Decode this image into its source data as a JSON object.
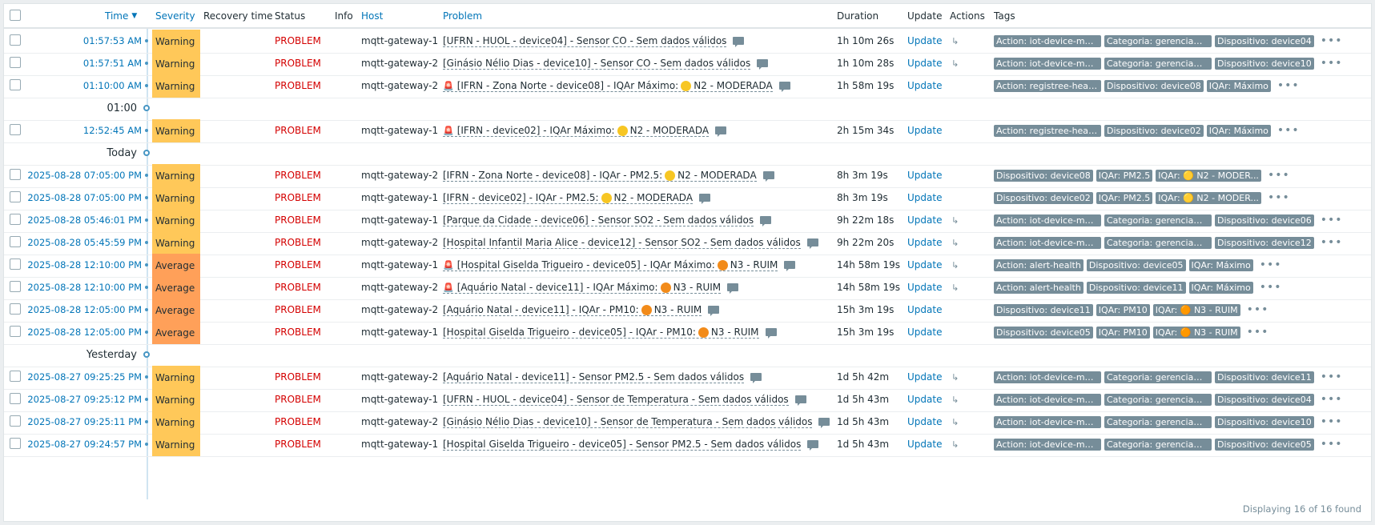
{
  "header": {
    "time": "Time",
    "severity": "Severity",
    "recovery_time": "Recovery time",
    "status": "Status",
    "info": "Info",
    "host": "Host",
    "problem": "Problem",
    "duration": "Duration",
    "update": "Update",
    "actions": "Actions",
    "tags": "Tags"
  },
  "rows": [
    {
      "kind": "event",
      "time": "01:57:53 AM",
      "severity": "Warning",
      "status": "PROBLEM",
      "host": "mqtt-gateway-1",
      "problem": "[UFRN - HUOL - device04] - Sensor CO - Sem dados válidos",
      "duration": "1h 10m 26s",
      "update": "Update",
      "actions": "↳",
      "tags": [
        "Action: iot-device-mon...",
        "Categoria: gerenciam...",
        "Dispositivo: device04"
      ]
    },
    {
      "kind": "event",
      "time": "01:57:51 AM",
      "severity": "Warning",
      "status": "PROBLEM",
      "host": "mqtt-gateway-2",
      "problem": "[Ginásio Nélio Dias - device10] - Sensor CO - Sem dados válidos",
      "duration": "1h 10m 28s",
      "update": "Update",
      "actions": "↳",
      "tags": [
        "Action: iot-device-mon...",
        "Categoria: gerenciam...",
        "Dispositivo: device10"
      ]
    },
    {
      "kind": "event",
      "time": "01:10:00 AM",
      "severity": "Warning",
      "status": "PROBLEM",
      "host": "mqtt-gateway-2",
      "alarm": true,
      "problem_pre": "[IFRN - Zona Norte - device08] - IQAr Máximo:",
      "dot": "yellow",
      "problem_post": "N2 - MODERADA",
      "duration": "1h 58m 19s",
      "update": "Update",
      "actions": "",
      "tags": [
        "Action: registree-health",
        "Dispositivo: device08",
        "IQAr: Máximo"
      ]
    },
    {
      "kind": "sep",
      "label": "01:00"
    },
    {
      "kind": "event",
      "time": "12:52:45 AM",
      "severity": "Warning",
      "status": "PROBLEM",
      "host": "mqtt-gateway-1",
      "alarm": true,
      "problem_pre": "[IFRN - device02] - IQAr Máximo:",
      "dot": "yellow",
      "problem_post": "N2 - MODERADA",
      "duration": "2h 15m 34s",
      "update": "Update",
      "actions": "",
      "tags": [
        "Action: registree-health",
        "Dispositivo: device02",
        "IQAr: Máximo"
      ]
    },
    {
      "kind": "sep",
      "label": "Today"
    },
    {
      "kind": "event",
      "time": "2025-08-28 07:05:00 PM",
      "severity": "Warning",
      "status": "PROBLEM",
      "host": "mqtt-gateway-2",
      "problem_pre": "[IFRN - Zona Norte - device08] - IQAr - PM2.5:",
      "dot": "yellow",
      "problem_post": "N2 - MODERADA",
      "duration": "8h 3m 19s",
      "update": "Update",
      "actions": "",
      "tags": [
        "Dispositivo: device08",
        "IQAr: PM2.5",
        "IQAr: 🟡 N2 - MODER..."
      ]
    },
    {
      "kind": "event",
      "time": "2025-08-28 07:05:00 PM",
      "severity": "Warning",
      "status": "PROBLEM",
      "host": "mqtt-gateway-1",
      "problem_pre": "[IFRN - device02] - IQAr - PM2.5:",
      "dot": "yellow",
      "problem_post": "N2 - MODERADA",
      "duration": "8h 3m 19s",
      "update": "Update",
      "actions": "",
      "tags": [
        "Dispositivo: device02",
        "IQAr: PM2.5",
        "IQAr: 🟡 N2 - MODER..."
      ]
    },
    {
      "kind": "event",
      "time": "2025-08-28 05:46:01 PM",
      "severity": "Warning",
      "status": "PROBLEM",
      "host": "mqtt-gateway-1",
      "problem": "[Parque da Cidade - device06] - Sensor SO2 - Sem dados válidos",
      "duration": "9h 22m 18s",
      "update": "Update",
      "actions": "↳",
      "tags": [
        "Action: iot-device-mon...",
        "Categoria: gerenciam...",
        "Dispositivo: device06"
      ]
    },
    {
      "kind": "event",
      "time": "2025-08-28 05:45:59 PM",
      "severity": "Warning",
      "status": "PROBLEM",
      "host": "mqtt-gateway-2",
      "problem": "[Hospital Infantil Maria Alice - device12] - Sensor SO2 - Sem dados válidos",
      "duration": "9h 22m 20s",
      "update": "Update",
      "actions": "↳",
      "tags": [
        "Action: iot-device-mon...",
        "Categoria: gerenciam...",
        "Dispositivo: device12"
      ]
    },
    {
      "kind": "event",
      "time": "2025-08-28 12:10:00 PM",
      "severity": "Average",
      "status": "PROBLEM",
      "host": "mqtt-gateway-1",
      "alarm": true,
      "problem_pre": "[Hospital Giselda Trigueiro - device05] - IQAr Máximo:",
      "dot": "orange",
      "problem_post": "N3 - RUIM",
      "duration": "14h 58m 19s",
      "update": "Update",
      "actions": "↳",
      "tags": [
        "Action: alert-health",
        "Dispositivo: device05",
        "IQAr: Máximo"
      ]
    },
    {
      "kind": "event",
      "time": "2025-08-28 12:10:00 PM",
      "severity": "Average",
      "status": "PROBLEM",
      "host": "mqtt-gateway-2",
      "alarm": true,
      "problem_pre": "[Aquário Natal - device11] - IQAr Máximo:",
      "dot": "orange",
      "problem_post": "N3 - RUIM",
      "duration": "14h 58m 19s",
      "update": "Update",
      "actions": "↳",
      "tags": [
        "Action: alert-health",
        "Dispositivo: device11",
        "IQAr: Máximo"
      ]
    },
    {
      "kind": "event",
      "time": "2025-08-28 12:05:00 PM",
      "severity": "Average",
      "status": "PROBLEM",
      "host": "mqtt-gateway-2",
      "problem_pre": "[Aquário Natal - device11] - IQAr - PM10:",
      "dot": "orange",
      "problem_post": "N3 - RUIM",
      "duration": "15h 3m 19s",
      "update": "Update",
      "actions": "",
      "tags": [
        "Dispositivo: device11",
        "IQAr: PM10",
        "IQAr: 🟠 N3 - RUIM"
      ]
    },
    {
      "kind": "event",
      "time": "2025-08-28 12:05:00 PM",
      "severity": "Average",
      "status": "PROBLEM",
      "host": "mqtt-gateway-1",
      "problem_pre": "[Hospital Giselda Trigueiro - device05] - IQAr - PM10:",
      "dot": "orange",
      "problem_post": "N3 - RUIM",
      "duration": "15h 3m 19s",
      "update": "Update",
      "actions": "",
      "tags": [
        "Dispositivo: device05",
        "IQAr: PM10",
        "IQAr: 🟠 N3 - RUIM"
      ]
    },
    {
      "kind": "sep",
      "label": "Yesterday"
    },
    {
      "kind": "event",
      "time": "2025-08-27 09:25:25 PM",
      "severity": "Warning",
      "status": "PROBLEM",
      "host": "mqtt-gateway-2",
      "problem": "[Aquário Natal - device11] - Sensor PM2.5 - Sem dados válidos",
      "duration": "1d 5h 42m",
      "update": "Update",
      "actions": "↳",
      "tags": [
        "Action: iot-device-mon...",
        "Categoria: gerenciam...",
        "Dispositivo: device11"
      ]
    },
    {
      "kind": "event",
      "time": "2025-08-27 09:25:12 PM",
      "severity": "Warning",
      "status": "PROBLEM",
      "host": "mqtt-gateway-1",
      "problem": "[UFRN - HUOL - device04] - Sensor de Temperatura - Sem dados válidos",
      "duration": "1d 5h 43m",
      "update": "Update",
      "actions": "↳",
      "tags": [
        "Action: iot-device-mon...",
        "Categoria: gerenciam...",
        "Dispositivo: device04"
      ]
    },
    {
      "kind": "event",
      "time": "2025-08-27 09:25:11 PM",
      "severity": "Warning",
      "status": "PROBLEM",
      "host": "mqtt-gateway-2",
      "problem": "[Ginásio Nélio Dias - device10] - Sensor de Temperatura - Sem dados válidos",
      "duration": "1d 5h 43m",
      "update": "Update",
      "actions": "↳",
      "tags": [
        "Action: iot-device-mon...",
        "Categoria: gerenciam...",
        "Dispositivo: device10"
      ]
    },
    {
      "kind": "event",
      "time": "2025-08-27 09:24:57 PM",
      "severity": "Warning",
      "status": "PROBLEM",
      "host": "mqtt-gateway-1",
      "problem": "[Hospital Giselda Trigueiro - device05] - Sensor PM2.5 - Sem dados válidos",
      "duration": "1d 5h 43m",
      "update": "Update",
      "actions": "↳",
      "tags": [
        "Action: iot-device-mon...",
        "Categoria: gerenciam...",
        "Dispositivo: device05"
      ]
    }
  ],
  "footer": "Displaying 16 of 16 found",
  "colors": {
    "warning": "#ffc859",
    "average": "#ffa059",
    "problem": "#d40000",
    "link": "#0275b8",
    "tag_bg": "#768d99"
  }
}
